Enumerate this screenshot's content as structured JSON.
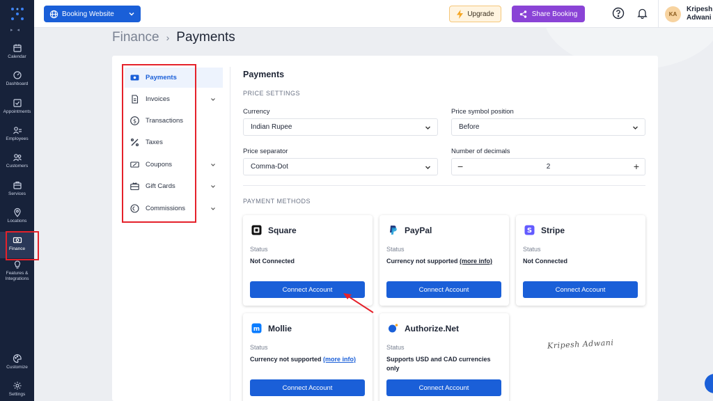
{
  "topbar": {
    "site_selector": "Booking Website",
    "upgrade": "Upgrade",
    "share_booking": "Share Booking",
    "avatar_initials": "KA",
    "user_name_line1": "Kripesh",
    "user_name_line2": "Adwani"
  },
  "leftnav": {
    "items": [
      {
        "label": "Calendar",
        "icon": "calendar-icon"
      },
      {
        "label": "Dashboard",
        "icon": "dashboard-icon"
      },
      {
        "label": "Appointments",
        "icon": "appointments-icon"
      },
      {
        "label": "Employees",
        "icon": "employees-icon"
      },
      {
        "label": "Customers",
        "icon": "customers-icon"
      },
      {
        "label": "Services",
        "icon": "services-icon"
      },
      {
        "label": "Locations",
        "icon": "location-pin-icon"
      },
      {
        "label": "Finance",
        "icon": "finance-icon"
      },
      {
        "label_line1": "Features &",
        "label_line2": "Integrations",
        "icon": "lightbulb-icon"
      },
      {
        "label": "Customize",
        "icon": "palette-icon"
      },
      {
        "label": "Settings",
        "icon": "gear-icon"
      }
    ],
    "active": "Finance"
  },
  "breadcrumb": {
    "root": "Finance",
    "current": "Payments"
  },
  "submenu": {
    "items": [
      {
        "label": "Payments",
        "icon": "payments-icon"
      },
      {
        "label": "Invoices",
        "icon": "invoice-icon"
      },
      {
        "label": "Transactions",
        "icon": "dollar-circle-icon"
      },
      {
        "label": "Taxes",
        "icon": "percent-icon"
      },
      {
        "label": "Coupons",
        "icon": "coupon-icon"
      },
      {
        "label": "Gift Cards",
        "icon": "gift-card-icon"
      },
      {
        "label": "Commissions",
        "icon": "commission-icon"
      }
    ],
    "active": "Payments"
  },
  "main": {
    "title": "Payments",
    "price_settings_label": "PRICE SETTINGS",
    "currency_label": "Currency",
    "currency_value": "Indian Rupee",
    "symbol_position_label": "Price symbol position",
    "symbol_position_value": "Before",
    "separator_label": "Price separator",
    "separator_value": "Comma-Dot",
    "decimals_label": "Number of decimals",
    "decimals_value": "2",
    "payment_methods_label": "PAYMENT METHODS",
    "status_label": "Status",
    "connect_label": "Connect Account",
    "methods": [
      {
        "name": "Square",
        "status": "Not Connected"
      },
      {
        "name": "PayPal",
        "status": "Currency not supported",
        "more": "(more info)"
      },
      {
        "name": "Stripe",
        "status": "Not Connected"
      },
      {
        "name": "Mollie",
        "status": "Currency not supported",
        "more": "(more info)"
      },
      {
        "name": "Authorize.Net",
        "status": "Supports USD and CAD currencies only"
      }
    ]
  },
  "signature": "Kripesh Adwani",
  "colors": {
    "primary": "#1a5fd8",
    "nav_bg": "#17223a",
    "share": "#8a43d6",
    "highlight": "#e5212a"
  }
}
